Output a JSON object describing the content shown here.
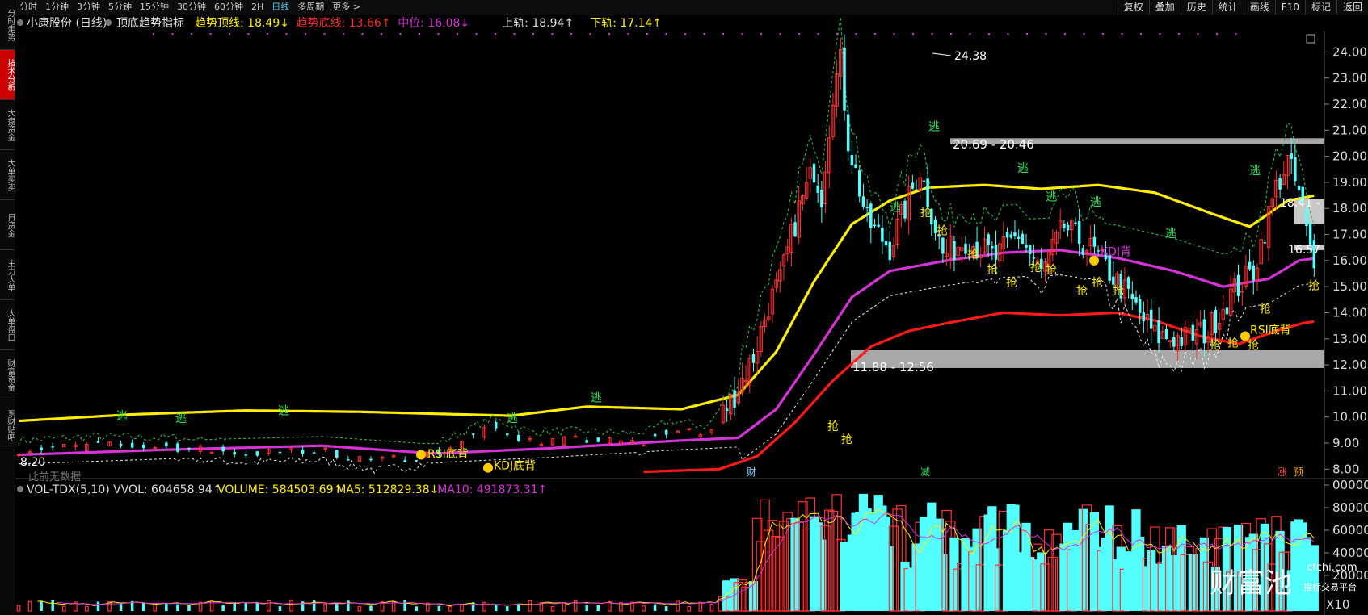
{
  "sidebar": {
    "items": [
      "分时走势",
      "技术分析",
      "大盘资金",
      "大单买卖",
      "日资金",
      "主力大单",
      "大单盘口",
      "财富资金",
      "东财贴吧"
    ]
  },
  "topbar": {
    "timeframes": [
      "分时",
      "1分钟",
      "3分钟",
      "5分钟",
      "15分钟",
      "30分钟",
      "60分钟",
      "2H",
      "日线",
      "多周期",
      "更多 >"
    ],
    "active": "日线",
    "tools": [
      "复权",
      "叠加",
      "历史",
      "统计",
      "画线",
      "F10",
      "标记",
      "返回"
    ]
  },
  "header": {
    "stock": "小康股份 (日线)",
    "indicator": "顶底趋势指标",
    "items": [
      {
        "label": "趋势顶线: 18.49↓",
        "color": "#ffee00"
      },
      {
        "label": "趋势底线: 13.66↑",
        "color": "#ff2a2a"
      },
      {
        "label": "中位: 16.08↓",
        "color": "#d633d6"
      },
      {
        "label": "上轨: 18.94↑",
        "color": "#dddddd"
      },
      {
        "label": "下轨: 17.14↑",
        "color": "#ffee00"
      }
    ]
  },
  "volheader": {
    "items": [
      {
        "label": "VOL-TDX(5,10) VVOL: 604658.94↑",
        "color": "#dddddd"
      },
      {
        "label": "VOLUME: 584503.69↑",
        "color": "#ffee00"
      },
      {
        "label": "MA5: 512829.38↓",
        "color": "#ffee00"
      },
      {
        "label": "MA10: 491873.31↑",
        "color": "#d633d6"
      }
    ]
  },
  "annotations": {
    "high": "24.38",
    "low": "8.20",
    "zone_upper": "20.69 - 20.46",
    "zone_lower": "11.88 - 12.56",
    "right_a": "18.41 -",
    "right_b": "16.57",
    "escape": "逃",
    "grab": "抢",
    "div1": "RSI底背",
    "div2": "KDJ底背",
    "div3": "KDJ背",
    "div4": "RSI底背",
    "mark_cai": "财",
    "mark_jian": "减",
    "mark_zhang": "涨",
    "mark_yu": "预",
    "nodata": "此前无数据",
    "watermark": "财富池",
    "watermark_url": "cfchi.com",
    "watermark_sub": "指标交易平台",
    "vol_unit": "X10"
  },
  "colors": {
    "up": "#ff3333",
    "down": "#54ffff",
    "top": "#ffee00",
    "bottom": "#ff1a1a",
    "mid": "#d633d6",
    "zone": "#a8a8a8"
  },
  "chart_data": {
    "type": "candlestick",
    "title": "小康股份 (日线)",
    "price_axis": {
      "ylim": [
        7.7,
        24.6
      ],
      "ticks": [
        "24.00",
        "23.00",
        "22.00",
        "21.00",
        "20.00",
        "19.00",
        "18.00",
        "17.00",
        "16.00",
        "15.00",
        "14.00",
        "13.00",
        "12.00",
        "11.00",
        "10.00",
        "9.00",
        "8.00"
      ]
    },
    "volume_axis": {
      "ylim": [
        0,
        100000
      ],
      "ticks": [
        "00000",
        "80000",
        "60000",
        "40000",
        "20000"
      ],
      "unit": "X10"
    },
    "zones": [
      {
        "from": 20.46,
        "to": 20.69
      },
      {
        "from": 11.88,
        "to": 12.56
      },
      {
        "from": 17.4,
        "to": 18.35
      },
      {
        "from": 16.4,
        "to": 16.6
      }
    ],
    "anchors_close": [
      [
        0,
        8.75
      ],
      [
        20,
        8.9
      ],
      [
        40,
        8.85
      ],
      [
        60,
        8.6
      ],
      [
        80,
        8.7
      ],
      [
        95,
        8.3
      ],
      [
        110,
        8.6
      ],
      [
        125,
        9.6
      ],
      [
        135,
        9.1
      ],
      [
        150,
        9.1
      ],
      [
        165,
        9.0
      ],
      [
        172,
        9.5
      ],
      [
        182,
        9.3
      ],
      [
        188,
        10.6
      ],
      [
        194,
        12.3
      ],
      [
        198,
        14.3
      ],
      [
        201,
        15.2
      ],
      [
        206,
        18.0
      ],
      [
        210,
        19.5
      ],
      [
        212,
        18.5
      ],
      [
        215,
        22.5
      ],
      [
        217,
        23.6
      ],
      [
        219,
        20.6
      ],
      [
        224,
        17.5
      ],
      [
        230,
        16.5
      ],
      [
        238,
        19.5
      ],
      [
        244,
        16.2
      ],
      [
        250,
        16.8
      ],
      [
        258,
        16.1
      ],
      [
        264,
        17.0
      ],
      [
        270,
        15.5
      ],
      [
        276,
        17.3
      ],
      [
        284,
        16.3
      ],
      [
        292,
        14.8
      ],
      [
        300,
        13.1
      ],
      [
        308,
        13.0
      ],
      [
        314,
        13.3
      ],
      [
        320,
        14.7
      ],
      [
        326,
        15.6
      ],
      [
        332,
        18.8
      ],
      [
        335,
        19.8
      ],
      [
        338,
        18.6
      ],
      [
        342,
        15.6
      ]
    ],
    "top_line": [
      [
        0,
        9.85
      ],
      [
        30,
        10.1
      ],
      [
        60,
        10.25
      ],
      [
        90,
        10.2
      ],
      [
        130,
        10.05
      ],
      [
        150,
        10.4
      ],
      [
        175,
        10.3
      ],
      [
        190,
        10.85
      ],
      [
        200,
        12.5
      ],
      [
        210,
        15.2
      ],
      [
        220,
        17.4
      ],
      [
        230,
        18.3
      ],
      [
        240,
        18.8
      ],
      [
        255,
        18.9
      ],
      [
        270,
        18.75
      ],
      [
        285,
        18.9
      ],
      [
        300,
        18.6
      ],
      [
        315,
        17.8
      ],
      [
        325,
        17.3
      ],
      [
        335,
        18.3
      ],
      [
        342,
        18.49
      ]
    ],
    "mid_line": [
      [
        0,
        8.55
      ],
      [
        40,
        8.75
      ],
      [
        80,
        8.9
      ],
      [
        110,
        8.6
      ],
      [
        140,
        8.8
      ],
      [
        175,
        9.1
      ],
      [
        190,
        9.2
      ],
      [
        200,
        10.3
      ],
      [
        210,
        12.4
      ],
      [
        220,
        14.6
      ],
      [
        230,
        15.6
      ],
      [
        245,
        16.0
      ],
      [
        260,
        16.3
      ],
      [
        275,
        16.4
      ],
      [
        290,
        16.1
      ],
      [
        305,
        15.6
      ],
      [
        318,
        15.0
      ],
      [
        330,
        15.3
      ],
      [
        338,
        16.0
      ],
      [
        342,
        16.08
      ]
    ],
    "bottom_line": [
      [
        165,
        7.9
      ],
      [
        185,
        8.0
      ],
      [
        195,
        8.5
      ],
      [
        205,
        9.8
      ],
      [
        215,
        11.4
      ],
      [
        225,
        12.7
      ],
      [
        235,
        13.3
      ],
      [
        245,
        13.6
      ],
      [
        260,
        14.0
      ],
      [
        275,
        13.9
      ],
      [
        290,
        14.0
      ],
      [
        300,
        13.7
      ],
      [
        312,
        13.1
      ],
      [
        322,
        12.8
      ],
      [
        332,
        13.3
      ],
      [
        339,
        13.6
      ],
      [
        342,
        13.66
      ]
    ]
  }
}
